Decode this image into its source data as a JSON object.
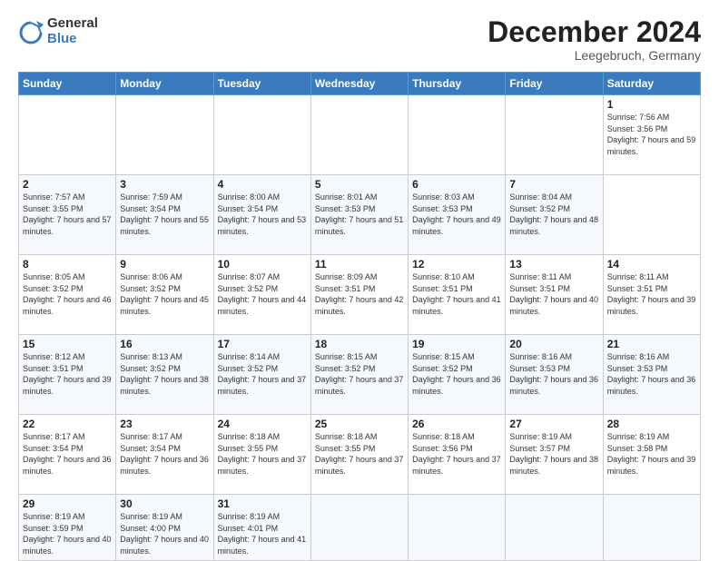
{
  "header": {
    "logo": {
      "general": "General",
      "blue": "Blue"
    },
    "title": "December 2024",
    "location": "Leegebruch, Germany"
  },
  "calendar": {
    "weekdays": [
      "Sunday",
      "Monday",
      "Tuesday",
      "Wednesday",
      "Thursday",
      "Friday",
      "Saturday"
    ],
    "weeks": [
      [
        null,
        null,
        null,
        null,
        null,
        null,
        {
          "day": 1,
          "sunrise": "7:56 AM",
          "sunset": "3:56 PM",
          "daylight": "7 hours and 59 minutes."
        }
      ],
      [
        {
          "day": 2,
          "sunrise": "7:57 AM",
          "sunset": "3:55 PM",
          "daylight": "7 hours and 57 minutes."
        },
        {
          "day": 3,
          "sunrise": "7:59 AM",
          "sunset": "3:54 PM",
          "daylight": "7 hours and 55 minutes."
        },
        {
          "day": 4,
          "sunrise": "8:00 AM",
          "sunset": "3:54 PM",
          "daylight": "7 hours and 53 minutes."
        },
        {
          "day": 5,
          "sunrise": "8:01 AM",
          "sunset": "3:53 PM",
          "daylight": "7 hours and 51 minutes."
        },
        {
          "day": 6,
          "sunrise": "8:03 AM",
          "sunset": "3:53 PM",
          "daylight": "7 hours and 49 minutes."
        },
        {
          "day": 7,
          "sunrise": "8:04 AM",
          "sunset": "3:52 PM",
          "daylight": "7 hours and 48 minutes."
        }
      ],
      [
        {
          "day": 8,
          "sunrise": "8:05 AM",
          "sunset": "3:52 PM",
          "daylight": "7 hours and 46 minutes."
        },
        {
          "day": 9,
          "sunrise": "8:06 AM",
          "sunset": "3:52 PM",
          "daylight": "7 hours and 45 minutes."
        },
        {
          "day": 10,
          "sunrise": "8:07 AM",
          "sunset": "3:52 PM",
          "daylight": "7 hours and 44 minutes."
        },
        {
          "day": 11,
          "sunrise": "8:09 AM",
          "sunset": "3:51 PM",
          "daylight": "7 hours and 42 minutes."
        },
        {
          "day": 12,
          "sunrise": "8:10 AM",
          "sunset": "3:51 PM",
          "daylight": "7 hours and 41 minutes."
        },
        {
          "day": 13,
          "sunrise": "8:11 AM",
          "sunset": "3:51 PM",
          "daylight": "7 hours and 40 minutes."
        },
        {
          "day": 14,
          "sunrise": "8:11 AM",
          "sunset": "3:51 PM",
          "daylight": "7 hours and 39 minutes."
        }
      ],
      [
        {
          "day": 15,
          "sunrise": "8:12 AM",
          "sunset": "3:51 PM",
          "daylight": "7 hours and 39 minutes."
        },
        {
          "day": 16,
          "sunrise": "8:13 AM",
          "sunset": "3:52 PM",
          "daylight": "7 hours and 38 minutes."
        },
        {
          "day": 17,
          "sunrise": "8:14 AM",
          "sunset": "3:52 PM",
          "daylight": "7 hours and 37 minutes."
        },
        {
          "day": 18,
          "sunrise": "8:15 AM",
          "sunset": "3:52 PM",
          "daylight": "7 hours and 37 minutes."
        },
        {
          "day": 19,
          "sunrise": "8:15 AM",
          "sunset": "3:52 PM",
          "daylight": "7 hours and 36 minutes."
        },
        {
          "day": 20,
          "sunrise": "8:16 AM",
          "sunset": "3:53 PM",
          "daylight": "7 hours and 36 minutes."
        },
        {
          "day": 21,
          "sunrise": "8:16 AM",
          "sunset": "3:53 PM",
          "daylight": "7 hours and 36 minutes."
        }
      ],
      [
        {
          "day": 22,
          "sunrise": "8:17 AM",
          "sunset": "3:54 PM",
          "daylight": "7 hours and 36 minutes."
        },
        {
          "day": 23,
          "sunrise": "8:17 AM",
          "sunset": "3:54 PM",
          "daylight": "7 hours and 36 minutes."
        },
        {
          "day": 24,
          "sunrise": "8:18 AM",
          "sunset": "3:55 PM",
          "daylight": "7 hours and 37 minutes."
        },
        {
          "day": 25,
          "sunrise": "8:18 AM",
          "sunset": "3:55 PM",
          "daylight": "7 hours and 37 minutes."
        },
        {
          "day": 26,
          "sunrise": "8:18 AM",
          "sunset": "3:56 PM",
          "daylight": "7 hours and 37 minutes."
        },
        {
          "day": 27,
          "sunrise": "8:19 AM",
          "sunset": "3:57 PM",
          "daylight": "7 hours and 38 minutes."
        },
        {
          "day": 28,
          "sunrise": "8:19 AM",
          "sunset": "3:58 PM",
          "daylight": "7 hours and 39 minutes."
        }
      ],
      [
        {
          "day": 29,
          "sunrise": "8:19 AM",
          "sunset": "3:59 PM",
          "daylight": "7 hours and 40 minutes."
        },
        {
          "day": 30,
          "sunrise": "8:19 AM",
          "sunset": "4:00 PM",
          "daylight": "7 hours and 40 minutes."
        },
        {
          "day": 31,
          "sunrise": "8:19 AM",
          "sunset": "4:01 PM",
          "daylight": "7 hours and 41 minutes."
        },
        null,
        null,
        null,
        null
      ]
    ]
  }
}
